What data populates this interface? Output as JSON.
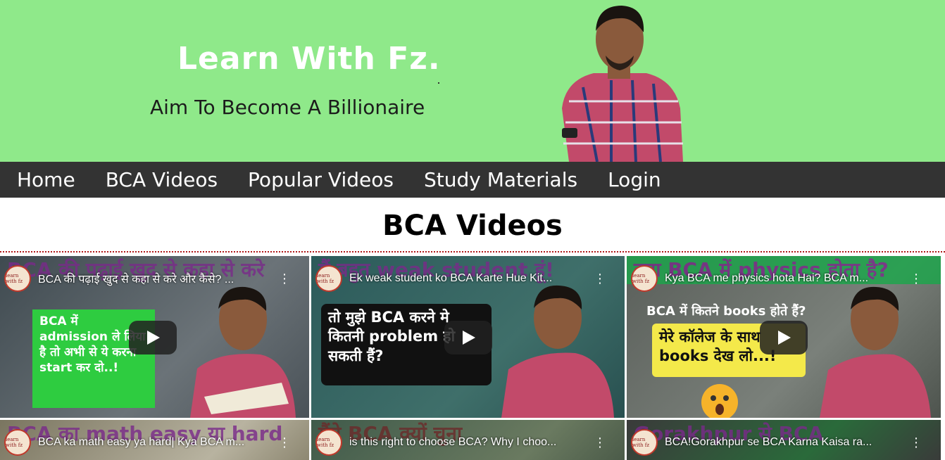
{
  "banner": {
    "title": "Learn With Fz.",
    "subtitle": "Aim To Become A Billionaire",
    "background": "#8fe98a"
  },
  "nav": {
    "items": [
      {
        "label": "Home"
      },
      {
        "label": "BCA Videos"
      },
      {
        "label": "Popular Videos"
      },
      {
        "label": "Study Materials"
      },
      {
        "label": "Login"
      }
    ],
    "background": "#333333"
  },
  "page": {
    "title": "BCA Videos"
  },
  "videos": [
    {
      "title": "BCA की पढ़ाई खुद से कहा से करे और कैसे? ...",
      "thumb_text": "BCA में admission ले लिया है तो अभी से ये करना start कर दो..!",
      "overlay": "BCA की पढ़ाई खुद से कहा से करे"
    },
    {
      "title": "Ek weak student ko BCA Karte Hue Kit...",
      "thumb_text": "तो मुझे BCA करने मे कितनी problem हो सकती हैं?",
      "overlay": "मैं बहुत weak student हूं!"
    },
    {
      "title": "Kya BCA me physics hota Hai? BCA m...",
      "thumb_text": "मेरे कॉलेज के साथ books देख लो...!",
      "thumb_text_2": "BCA में कितने books होते हैं?",
      "overlay": "क्या BCA में physics होता है?"
    },
    {
      "title": "BCA ka math easy ya hard| Kya BCA m...",
      "overlay": "BCA का math easy या hard"
    },
    {
      "title": "is this right to choose BCA? Why I choo...",
      "overlay": "मैंने BCA क्यों चुना"
    },
    {
      "title": "BCA!Gorakhpur se BCA Karna Kaisa ra...",
      "overlay": "Gorakhpur से BCA"
    }
  ],
  "channel_badge": "learn with fz",
  "icons": {
    "play": "play-icon",
    "more": "more-vert-icon"
  }
}
